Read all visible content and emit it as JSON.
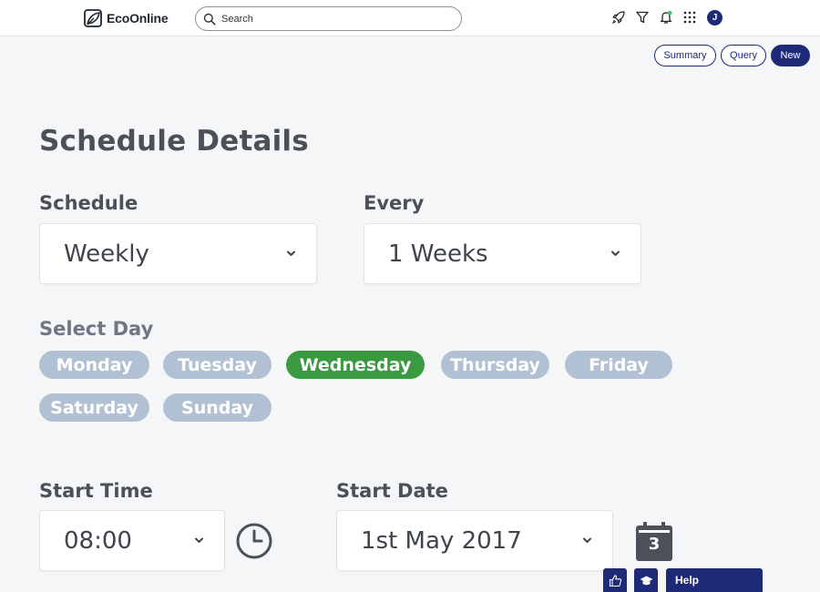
{
  "header": {
    "logo_text": "EcoOnline",
    "search_placeholder": "Search",
    "avatar_initial": "J"
  },
  "actions": {
    "summary": "Summary",
    "query": "Query",
    "new": "New"
  },
  "page": {
    "title": "Schedule Details"
  },
  "schedule": {
    "label": "Schedule",
    "value": "Weekly"
  },
  "every": {
    "label": "Every",
    "value": "1 Weeks"
  },
  "select_day": {
    "label": "Select Day",
    "days": [
      "Monday",
      "Tuesday",
      "Wednesday",
      "Thursday",
      "Friday",
      "Saturday",
      "Sunday"
    ],
    "selected": "Wednesday"
  },
  "start_time": {
    "label": "Start Time",
    "value": "08:00"
  },
  "start_date": {
    "label": "Start Date",
    "value": "1st May 2017",
    "calendar_day": "3"
  },
  "help": {
    "label": "Help"
  },
  "colors": {
    "brand_navy": "#1e2a78",
    "chip_inactive": "#b1c1d3",
    "chip_active": "#3b9941",
    "heading": "#4b5059"
  }
}
